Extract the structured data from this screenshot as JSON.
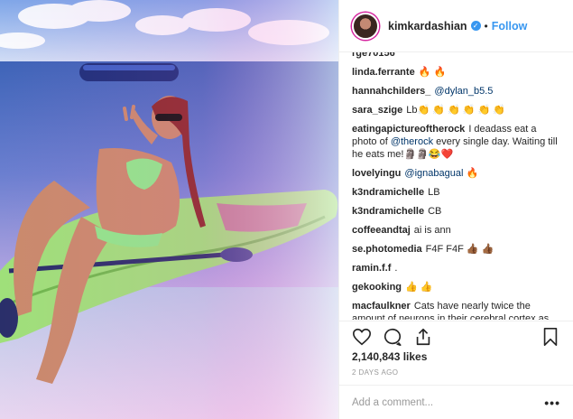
{
  "post": {
    "username": "kimkardashian",
    "follow_label": "Follow",
    "separator": "•",
    "verified_glyph": "✓",
    "likes": "2,140,843 likes",
    "date": "2 DAYS AGO",
    "add_comment_placeholder": "Add a comment...",
    "more_glyph": "•••"
  },
  "comments": [
    {
      "user": "rge70156",
      "text": "",
      "mention": "",
      "partial": true
    },
    {
      "user": "linda.ferrante",
      "text": "🔥 🔥",
      "mention": ""
    },
    {
      "user": "hannahchilders_",
      "text": "",
      "mention": "@dylan_b5.5"
    },
    {
      "user": "sara_szige",
      "text": "Lb👏 👏 👏 👏 👏 👏",
      "mention": ""
    },
    {
      "user": "eatingapictureoftherock",
      "text": "I deadass eat a photo of",
      "mention": "@therock",
      "text_after": "every single day. Waiting till he eats me!🗿🗿😂❤️"
    },
    {
      "user": "lovelyingu",
      "text": "",
      "mention": "@ignabagual",
      "text_after": "🔥"
    },
    {
      "user": "k3ndramichelle",
      "text": "LB",
      "mention": ""
    },
    {
      "user": "k3ndramichelle",
      "text": "CB",
      "mention": ""
    },
    {
      "user": "coffeeandtaj",
      "text": "ai is ann",
      "mention": ""
    },
    {
      "user": "se.photomedia",
      "text": "F4F F4F 👍🏾 👍🏾",
      "mention": ""
    },
    {
      "user": "ramin.f.f",
      "text": ".",
      "mention": ""
    },
    {
      "user": "gekooking",
      "text": "👍 👍",
      "mention": ""
    },
    {
      "user": "macfaulkner",
      "text": "Cats have nearly twice the amount of neurons in their cerebral cortex as dogs",
      "mention": ""
    }
  ],
  "icons": {
    "like": "heart-icon",
    "comment": "comment-icon",
    "share": "share-icon",
    "save": "bookmark-icon"
  },
  "colors": {
    "link": "#3897f0",
    "text": "#262626",
    "muted": "#999999",
    "border": "#efefef"
  }
}
